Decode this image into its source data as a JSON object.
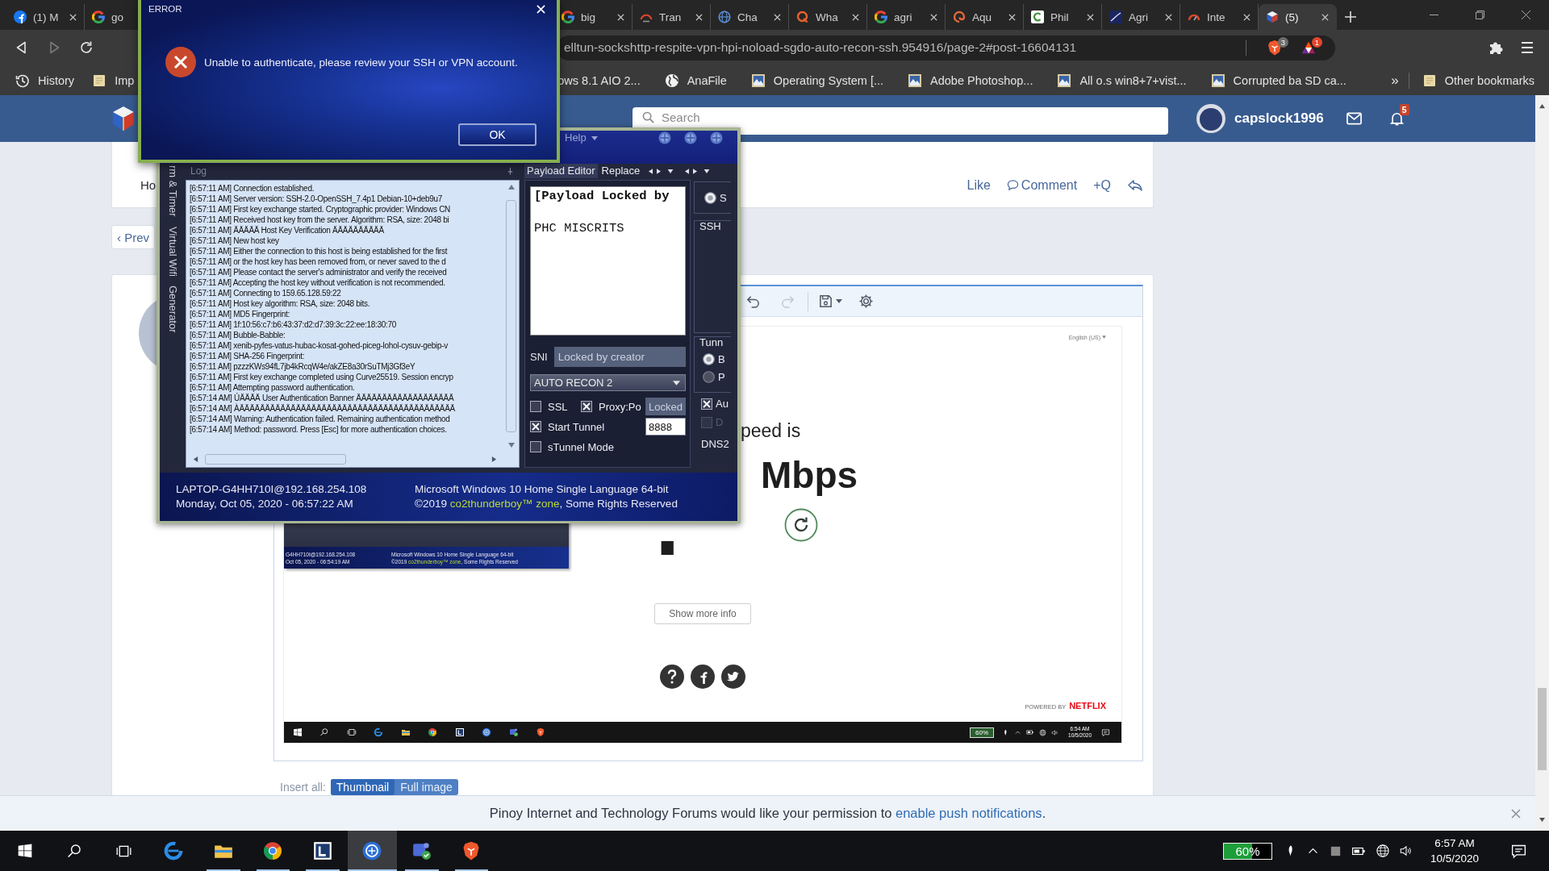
{
  "browser": {
    "tabs": [
      {
        "title": "(1) M",
        "selected": false
      },
      {
        "title": "go",
        "selected": false
      },
      {
        "title": "big",
        "selected": false
      },
      {
        "title": "Tran",
        "selected": false
      },
      {
        "title": "Cha",
        "selected": false
      },
      {
        "title": "Wha",
        "selected": false
      },
      {
        "title": "agri",
        "selected": false
      },
      {
        "title": "Aqu",
        "selected": false
      },
      {
        "title": "Phil",
        "selected": false
      },
      {
        "title": "Agri",
        "selected": false
      },
      {
        "title": "Inte",
        "selected": false
      },
      {
        "title": "(5)",
        "selected": true
      }
    ],
    "address": {
      "url": "elltun-sockshttp-respite-vpn-hpi-noload-sgdo-auto-recon-ssh.954916/page-2#post-16604131",
      "shields_badge": "3",
      "rewards_badge": "1"
    },
    "bookmarks": [
      {
        "label": "History"
      },
      {
        "label": "Imp"
      },
      {
        "label": "ows 8.1 AIO 2..."
      },
      {
        "label": "AnaFile"
      },
      {
        "label": "Operating System [..."
      },
      {
        "label": "Adobe Photoshop..."
      },
      {
        "label": "All o.s win8+7+vist..."
      },
      {
        "label": "Corrupted ba SD ca..."
      }
    ],
    "more_bookmarks": "»",
    "other_bookmarks": "Other bookmarks"
  },
  "forum": {
    "search_placeholder": "Search",
    "username": "capslock1996",
    "alerts_badge": "5",
    "post": {
      "text": "Ho",
      "actions": [
        "Like",
        "Comment",
        "+Q"
      ]
    },
    "prev": "‹ Prev",
    "editor": {
      "redo_disabled": true
    },
    "insert": {
      "label": "Insert all:",
      "options": [
        {
          "label": "Thumbnail",
          "selected": true
        },
        {
          "label": "Full image",
          "selected": false
        }
      ]
    }
  },
  "embedded": {
    "language": "English (US)",
    "speed_label": "peed is",
    "speed_value": ".",
    "unit": "Mbps",
    "more_info": "Show more info",
    "powered_by": "POWERED BY",
    "brand": "NETFLIX",
    "mini_window": {
      "host": "G4HH710I@192.168.254.108",
      "datetime": "Oct 05, 2020 - 06:54:19 AM",
      "os": "Microsoft Windows 10 Home Single Language 64-bit",
      "copyright": "©2019",
      "brand": "co2thunderboy™ zone",
      "rights": ", Some Rights Reserved"
    },
    "taskbar": {
      "battery": "60%",
      "time": "6:54 AM",
      "date": "10/5/2020"
    }
  },
  "notification": {
    "text": "Pinoy Internet and Technology Forums would like your permission to",
    "link": "enable push notifications",
    "end": "."
  },
  "vpn_app": {
    "menu": "Help",
    "side_tabs": [
      "rm & Timer",
      "Virtual Wifi",
      "Generator"
    ],
    "log": {
      "title": "Log",
      "lines": [
        "[6:57:11 AM] Connection established.",
        "[6:57:11 AM] Server version: SSH-2.0-OpenSSH_7.4p1 Debian-10+deb9u7",
        "[6:57:11 AM] First key exchange started. Cryptographic provider: Windows CN",
        "[6:57:11 AM] Received host key from the server. Algorithm: RSA, size: 2048 bi",
        "[6:57:11 AM] ÄÄÄÄÄ Host Key Verification ÄÄÄÄÄÄÄÄÄÄ",
        "[6:57:11 AM] New host key",
        "[6:57:11 AM] Either the connection to this host is being established for the first",
        "[6:57:11 AM] or the host key has been removed from, or never saved to the d",
        "[6:57:11 AM] Please contact the server's administrator and verify the received",
        "[6:57:11 AM] Accepting the host key without verification is not recommended.",
        "[6:57:11 AM] Connecting to 159.65.128.59:22",
        "[6:57:11 AM] Host key algorithm: RSA, size: 2048 bits.",
        "[6:57:11 AM] MD5 Fingerprint:",
        "[6:57:11 AM] 1f:10:56:c7:b6:43:37:d2:d7:39:3c:22:ee:18:30:70",
        "[6:57:11 AM] Bubble-Babble:",
        "[6:57:11 AM] xenib-pyfes-vatus-hubac-kosat-gohed-piceg-lohol-cysuv-gebip-v",
        "[6:57:11 AM] SHA-256 Fingerprint:",
        "[6:57:11 AM] pzzzKWs94fL7jb4kRcqW4e/akZE8a30rSuTMj3Gf3eY",
        "[6:57:11 AM] First key exchange completed using Curve25519. Session encryp",
        "[6:57:11 AM] Attempting password authentication.",
        "[6:57:14 AM] ÚÄÄÄÄ User Authentication Banner ÄÄÄÄÄÄÄÄÄÄÄÄÄÄÄÄÄÄÄ",
        "[6:57:14 AM] ÀÄÄÄÄÄÄÄÄÄÄÄÄÄÄÄÄÄÄÄÄÄÄÄÄÄÄÄÄÄÄÄÄÄÄÄÄÄÄÄÄÄÄ",
        "[6:57:14 AM] Warning: Authentication failed. Remaining authentication method",
        "[6:57:14 AM] Method: password. Press [Esc] for more authentication choices."
      ]
    },
    "payload_tabs": [
      {
        "label": "Payload Editor",
        "selected": true
      },
      {
        "label": "Replace",
        "selected": false
      }
    ],
    "payload": "**[Payload Locked by**\n\nPHC MISCRITS",
    "sni": {
      "label": "SNI",
      "value": "Locked by creator",
      "disabled": true
    },
    "profile": "AUTO RECON 2",
    "options": [
      {
        "label": "SSL",
        "checked": false
      },
      {
        "label": "Proxy:Po",
        "checked": true
      },
      {
        "label": "Start Tunnel",
        "checked": true
      },
      {
        "label": "sTunnel Mode",
        "checked": false
      }
    ],
    "proxy_field": {
      "value": "Locked",
      "disabled": true
    },
    "port_field": {
      "value": "8888",
      "disabled": false
    },
    "side": {
      "server": {
        "label": "S",
        "selected": true
      },
      "ssh_group": "SSH",
      "tunnel_group": "Tunn",
      "tunnel_modes": [
        {
          "label": "B",
          "selected": true
        },
        {
          "label": "P",
          "selected": false
        }
      ],
      "checks": [
        {
          "label": "Au",
          "checked": true,
          "disabled": false
        },
        {
          "label": "D",
          "checked": false,
          "disabled": true
        }
      ],
      "dns_label": "DNS2"
    },
    "footer": {
      "host": "LAPTOP-G4HH710I@192.168.254.108",
      "datetime": "Monday, Oct 05, 2020 - 06:57:22 AM",
      "os": "Microsoft Windows 10 Home Single Language 64-bit",
      "copyright": "©2019",
      "brand": "co2thunderboy™ zone",
      "rights": ", Some Rights Reserved"
    }
  },
  "error_dialog": {
    "title": "ERROR",
    "message": "Unable to authenticate, please review your SSH or VPN account.",
    "button": "OK"
  },
  "taskbar": {
    "apps": [
      {
        "running": false,
        "selected": false
      },
      {
        "running": true,
        "selected": false
      },
      {
        "running": true,
        "selected": false
      },
      {
        "running": true,
        "selected": false
      },
      {
        "running": true,
        "selected": true
      },
      {
        "running": true,
        "selected": false
      },
      {
        "running": true,
        "selected": false
      }
    ],
    "battery": {
      "reading": "60%",
      "level": 0.6
    },
    "time": "6:57 AM",
    "date": "10/5/2020"
  }
}
